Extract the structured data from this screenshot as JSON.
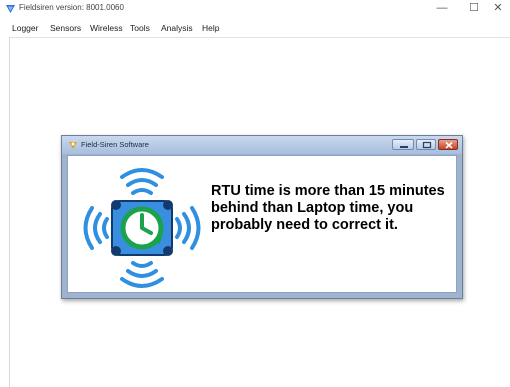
{
  "window": {
    "title": "Fieldsiren version: 8001.0060",
    "controls": {
      "minimize": "—",
      "maximize": "☐",
      "close": "✕"
    }
  },
  "menu": {
    "items": [
      "Logger",
      "Sensors",
      "Wireless",
      "Tools",
      "Analysis",
      "Help"
    ]
  },
  "dialog": {
    "title": "Field-Siren Software",
    "message": "RTU time is more than 15 minutes behind than Laptop time, you probably need to correct it.",
    "icon": "wireless-sensor-clock-icon",
    "colors": {
      "icon_blue": "#2f8fe0",
      "icon_dark": "#123a6e",
      "clock_green": "#1aa34a"
    }
  }
}
